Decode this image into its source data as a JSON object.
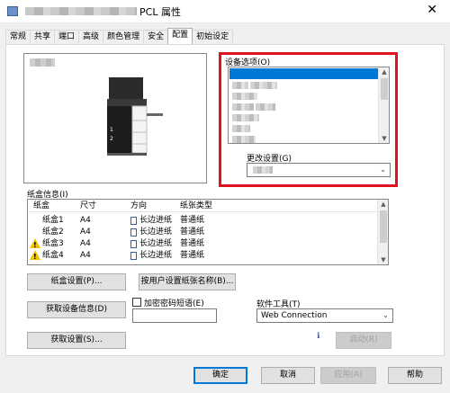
{
  "window": {
    "title": "PCL 属性",
    "close_glyph": "✕"
  },
  "tabs": [
    {
      "label": "常规"
    },
    {
      "label": "共享"
    },
    {
      "label": "端口"
    },
    {
      "label": "高级"
    },
    {
      "label": "颜色管理"
    },
    {
      "label": "安全"
    },
    {
      "label": "配置",
      "active": true
    },
    {
      "label": "初始设定"
    }
  ],
  "device_options": {
    "label": "设备选项(O)",
    "change_setting_label": "更改设置(G)"
  },
  "paper_tray_info": {
    "label": "纸盒信息(I)",
    "columns": [
      "纸盒",
      "尺寸",
      "方向",
      "纸张类型"
    ],
    "rows": [
      {
        "tray": "纸盒1",
        "size": "A4",
        "orientation": "长边进纸",
        "type": "普通纸",
        "warning": false
      },
      {
        "tray": "纸盒2",
        "size": "A4",
        "orientation": "长边进纸",
        "type": "普通纸",
        "warning": false
      },
      {
        "tray": "纸盒3",
        "size": "A4",
        "orientation": "长边进纸",
        "type": "普通纸",
        "warning": true
      },
      {
        "tray": "纸盒4",
        "size": "A4",
        "orientation": "长边进纸",
        "type": "普通纸",
        "warning": true
      }
    ]
  },
  "buttons": {
    "tray_settings": "纸盒设置(P)...",
    "user_paper_name": "按用户设置纸张名称(B)...",
    "get_device_info": "获取设备信息(D)",
    "get_settings": "获取设置(S)...",
    "launch": "启动(R)",
    "ok": "确定",
    "cancel": "取消",
    "apply": "应用(A)",
    "help": "帮助"
  },
  "encryption": {
    "label": "加密密码短语(E)",
    "checked": false,
    "value": ""
  },
  "software_tools": {
    "label": "软件工具(T)",
    "selected": "Web Connection"
  },
  "colors": {
    "selection": "#0078d7",
    "highlight_frame": "#e0121d",
    "warning": "#f2c200"
  }
}
